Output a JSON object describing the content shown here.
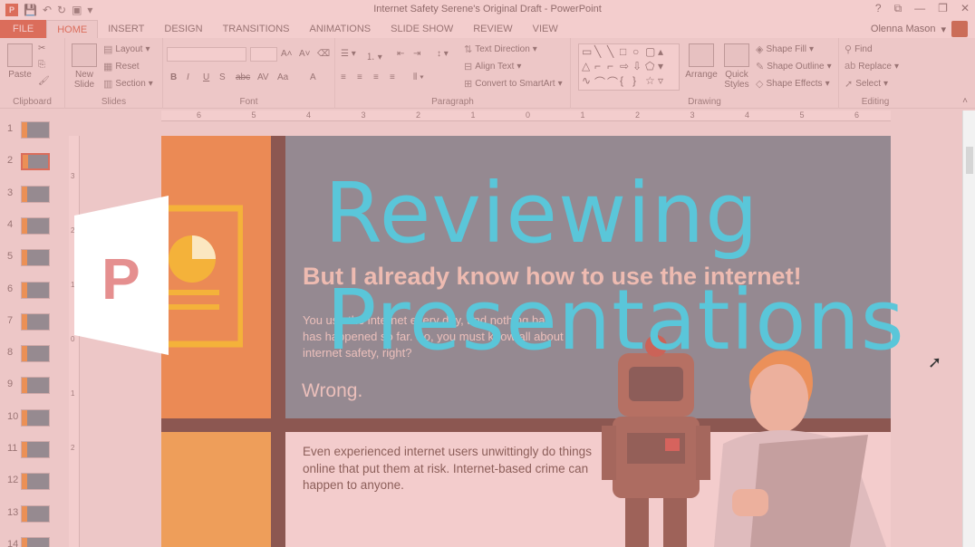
{
  "window": {
    "title": "Internet Safety Serene's Original Draft - PowerPoint",
    "controls": [
      "?",
      "⧉",
      "—",
      "❐",
      "✕"
    ]
  },
  "qat_icons": [
    "save-icon",
    "undo-icon",
    "redo-icon",
    "start-from-beginning-icon"
  ],
  "tabs": [
    {
      "label": "FILE"
    },
    {
      "label": "HOME"
    },
    {
      "label": "INSERT"
    },
    {
      "label": "DESIGN"
    },
    {
      "label": "TRANSITIONS"
    },
    {
      "label": "ANIMATIONS"
    },
    {
      "label": "SLIDE SHOW"
    },
    {
      "label": "REVIEW"
    },
    {
      "label": "VIEW"
    }
  ],
  "user": {
    "name": "Olenna Mason"
  },
  "ribbon": {
    "clipboard": {
      "label": "Clipboard",
      "paste": "Paste"
    },
    "slides": {
      "label": "Slides",
      "new_slide": "New",
      "new_slide_2": "Slide",
      "layout": "Layout",
      "reset": "Reset",
      "section": "Section"
    },
    "font": {
      "label": "Font",
      "bold": "B",
      "italic": "I",
      "underline": "U",
      "shadow": "S",
      "strike": "abc",
      "spacing": "AV",
      "case": "Aa",
      "color": "A"
    },
    "paragraph": {
      "label": "Paragraph",
      "text_direction": "Text Direction",
      "align_text": "Align Text",
      "convert_smartart": "Convert to SmartArt"
    },
    "drawing": {
      "label": "Drawing",
      "arrange": "Arrange",
      "quick_styles": "Quick",
      "quick_styles_2": "Styles",
      "shape_fill": "Shape Fill",
      "shape_outline": "Shape Outline",
      "shape_effects": "Shape Effects"
    },
    "editing": {
      "label": "Editing",
      "find": "Find",
      "replace": "Replace",
      "select": "Select"
    }
  },
  "ruler": {
    "h_ticks": [
      "6",
      "5",
      "4",
      "3",
      "2",
      "1",
      "0",
      "1",
      "2",
      "3",
      "4",
      "5",
      "6"
    ],
    "v_ticks": [
      "3",
      "2",
      "1",
      "0",
      "1",
      "2"
    ]
  },
  "thumbnails": [
    {
      "num": "1"
    },
    {
      "num": "2",
      "selected": true
    },
    {
      "num": "3"
    },
    {
      "num": "4"
    },
    {
      "num": "5"
    },
    {
      "num": "6"
    },
    {
      "num": "7"
    },
    {
      "num": "8"
    },
    {
      "num": "9"
    },
    {
      "num": "10"
    },
    {
      "num": "11"
    },
    {
      "num": "12"
    },
    {
      "num": "13"
    },
    {
      "num": "14"
    }
  ],
  "slide": {
    "heading": "But I already know how to use the internet!",
    "body": "You use the internet every day, and nothing bad has happened so far. So, you must know all about internet safety, right?",
    "wrong": "Wrong.",
    "lower": "Even experienced internet users unwittingly do things online that put them at risk. Internet-based crime can happen to anyone."
  },
  "intro": {
    "line1": "Reviewing",
    "line2": "Presentations",
    "title_color": "#5ac6d9"
  },
  "colors": {
    "accent": "#d24726",
    "slide_orange": "#f07f1a",
    "slide_teal": "#4b7e8c",
    "overlay_pink": "#e69696"
  }
}
